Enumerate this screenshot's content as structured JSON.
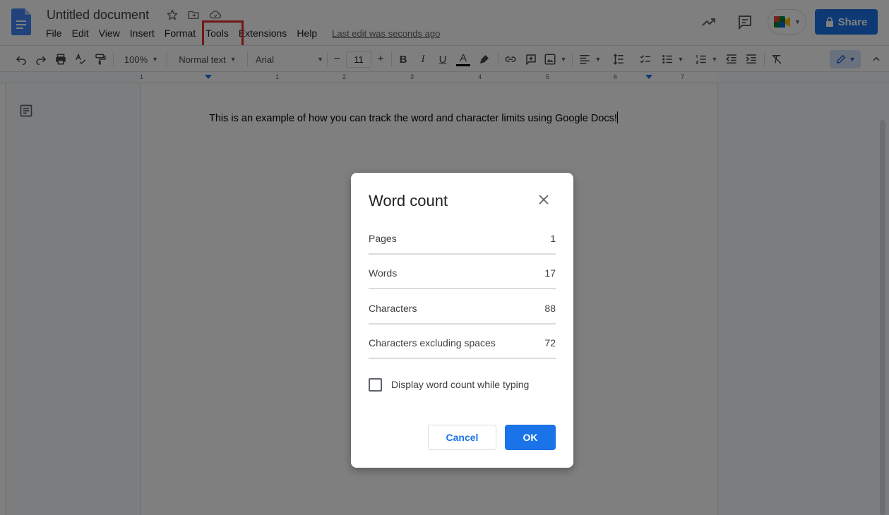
{
  "app": {
    "doc_title": "Untitled document",
    "last_edit": "Last edit was seconds ago",
    "share_label": "Share"
  },
  "menu": [
    "File",
    "Edit",
    "View",
    "Insert",
    "Format",
    "Tools",
    "Extensions",
    "Help"
  ],
  "toolbar": {
    "zoom": "100%",
    "style": "Normal text",
    "font": "Arial",
    "font_size": "11"
  },
  "ruler": [
    "1",
    "1",
    "2",
    "3",
    "4",
    "5",
    "6",
    "7"
  ],
  "document": {
    "text": "This is an example of how you can track the word and character limits using Google Docs!"
  },
  "dialog": {
    "title": "Word count",
    "rows": [
      {
        "label": "Pages",
        "value": "1"
      },
      {
        "label": "Words",
        "value": "17"
      },
      {
        "label": "Characters",
        "value": "88"
      },
      {
        "label": "Characters excluding spaces",
        "value": "72"
      }
    ],
    "checkbox_label": "Display word count while typing",
    "checkbox_checked": false,
    "cancel_label": "Cancel",
    "ok_label": "OK"
  },
  "colors": {
    "accent": "#1a73e8",
    "highlight_box": "#e0312b",
    "overlay": "rgba(0,0,0,0.5)"
  }
}
